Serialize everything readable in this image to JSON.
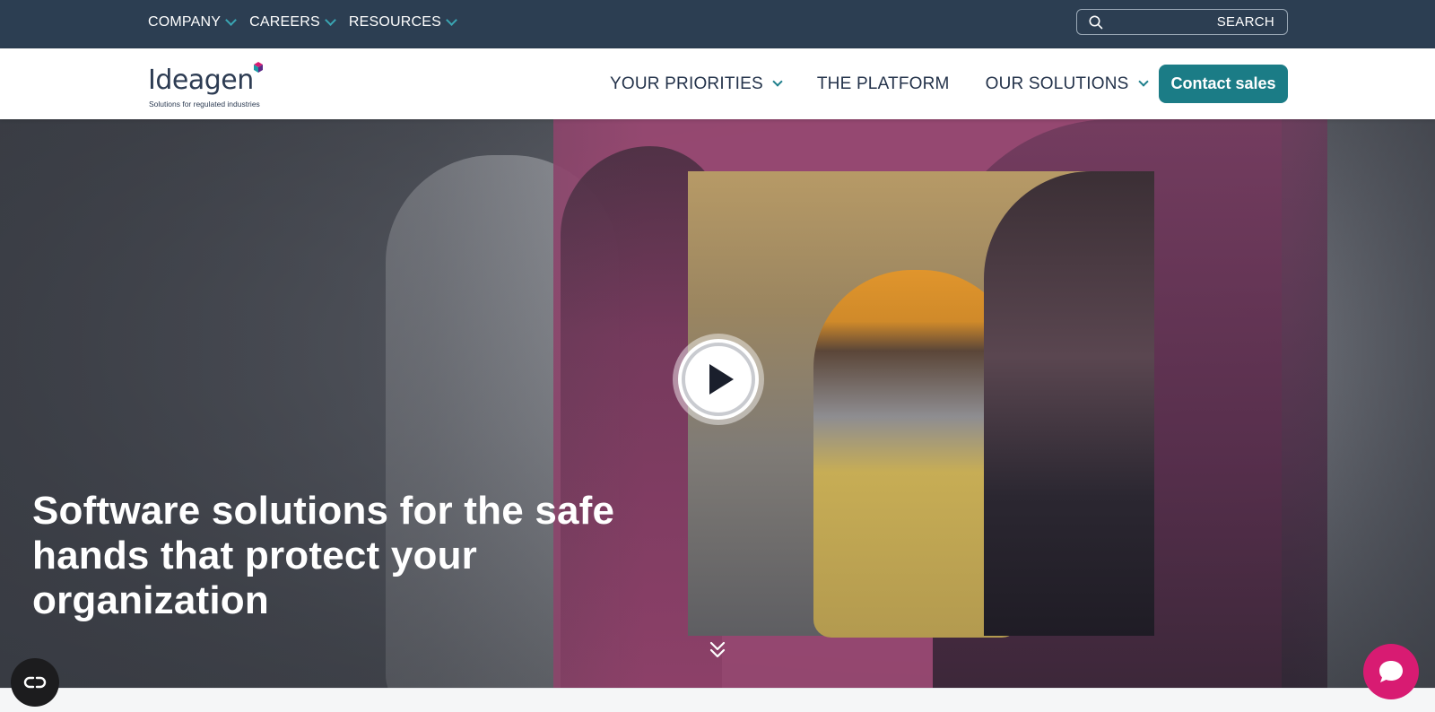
{
  "topbar": {
    "items": [
      {
        "label": "COMPANY"
      },
      {
        "label": "CAREERS"
      },
      {
        "label": "RESOURCES"
      }
    ],
    "search": {
      "label": "SEARCH",
      "placeholder": ""
    }
  },
  "mainnav": {
    "logo": {
      "word": "Ideagen",
      "tagline": "Solutions for regulated industries"
    },
    "items": [
      {
        "label": "YOUR PRIORITIES",
        "dropdown": true
      },
      {
        "label": "THE PLATFORM",
        "dropdown": false
      },
      {
        "label": "OUR SOLUTIONS",
        "dropdown": true
      }
    ],
    "cta": {
      "label": "Contact sales"
    }
  },
  "hero": {
    "title": "Software solutions for the safe hands that protect your organization",
    "video_icon": "play-icon",
    "scroll_icon": "double-chevron-down-icon"
  },
  "floating": {
    "accessibility_icon": "accessibility-icon",
    "chat_icon": "chat-bubble-icon"
  },
  "colors": {
    "topbar_bg": "#2c3e52",
    "accent_teal": "#1b7c86",
    "chevron_teal": "#3aa6b3",
    "magenta_frame": "#9a4772",
    "chat_pink": "#d81b72",
    "nav_text": "#23324a"
  }
}
